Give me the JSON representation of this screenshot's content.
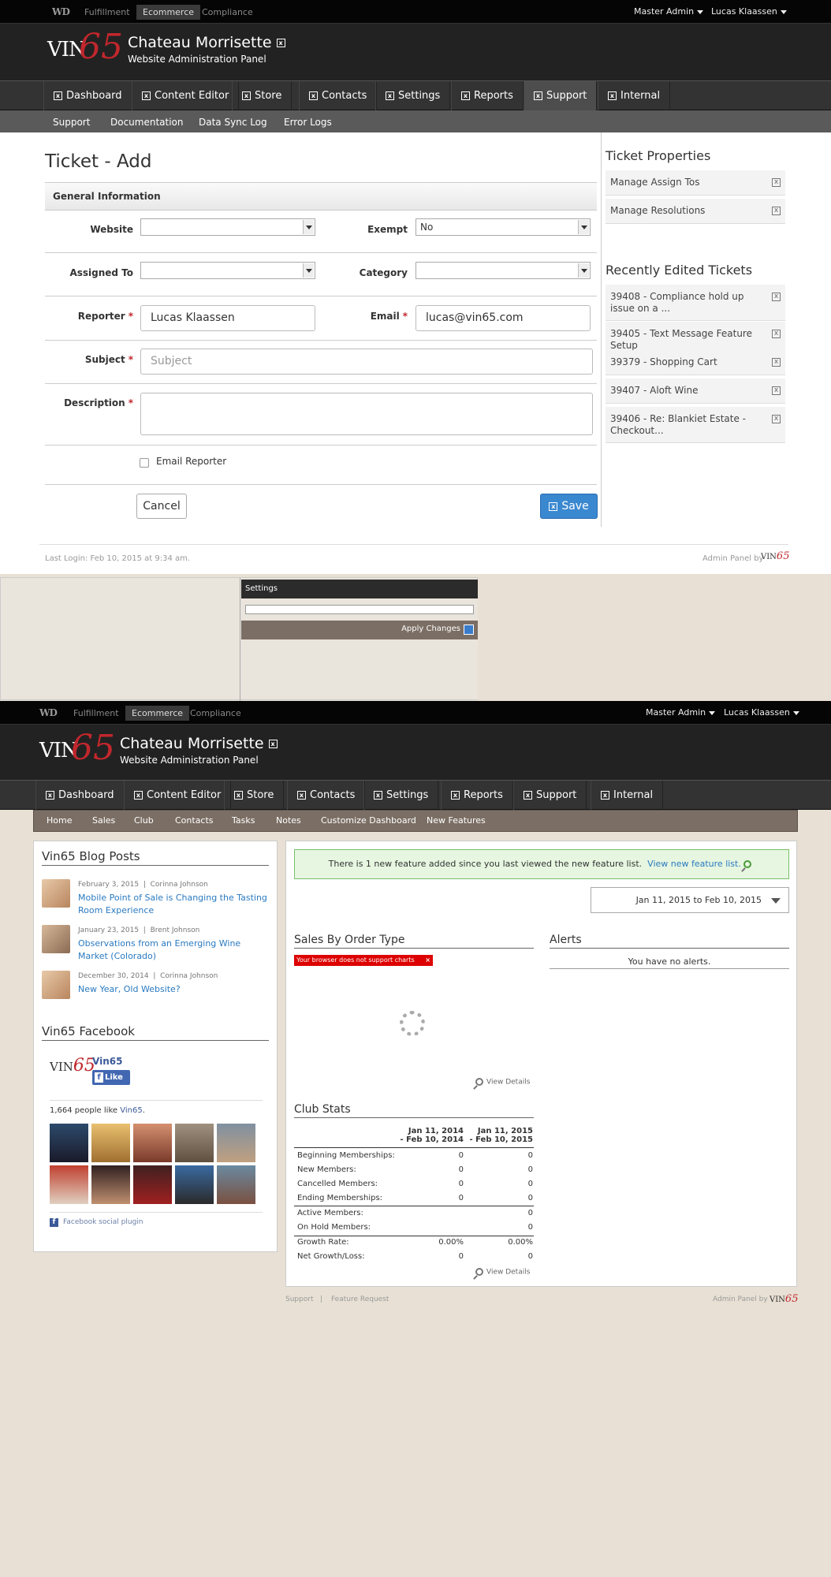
{
  "topbar": {
    "wd": "WD",
    "tabs": [
      "Fulfillment",
      "Ecommerce",
      "Compliance"
    ],
    "master": "Master Admin",
    "user": "Lucas Klaassen"
  },
  "header": {
    "logo_vin": "VIN",
    "logo_65": "65",
    "title": "Chateau Morrisette",
    "subtitle": "Website Administration Panel"
  },
  "nav": [
    "Dashboard",
    "Content Editor",
    "Store",
    "Contacts",
    "Settings",
    "Reports",
    "Support",
    "Internal"
  ],
  "subnav": [
    "Support",
    "Documentation",
    "Data Sync Log",
    "Error Logs"
  ],
  "ticket": {
    "page_title": "Ticket - Add",
    "section": "General Information",
    "website_label": "Website",
    "exempt_label": "Exempt",
    "exempt_value": "No",
    "assigned_label": "Assigned To",
    "category_label": "Category",
    "reporter_label": "Reporter",
    "reporter_value": "Lucas Klaassen",
    "email_label": "Email",
    "email_value": "lucas@vin65.com",
    "subject_label": "Subject",
    "subject_placeholder": "Subject",
    "description_label": "Description",
    "required_mark": "*",
    "email_reporter": "Email Reporter",
    "cancel": "Cancel",
    "save": "Save"
  },
  "sidebar": {
    "props_title": "Ticket Properties",
    "props": [
      "Manage Assign Tos",
      "Manage Resolutions"
    ],
    "recent_title": "Recently Edited Tickets",
    "recent": [
      "39408 - Compliance hold up issue on a ...",
      "39405 - Text Message Feature Setup",
      "39379 - Shopping Cart",
      "39407 - Aloft Wine",
      "39406 - Re: Blankiet Estate - Checkout..."
    ]
  },
  "footer1": {
    "last_login": "Last Login: Feb 10, 2015 at 9:34 am.",
    "admin_by": "Admin Panel by"
  },
  "settings_panel": {
    "title": "Settings",
    "apply": "Apply Changes"
  },
  "dashboard": {
    "subnav": [
      "Home",
      "Sales",
      "Club",
      "Contacts",
      "Tasks",
      "Notes",
      "Customize Dashboard",
      "New Features"
    ],
    "blog_title": "Vin65 Blog Posts",
    "posts": [
      {
        "date": "February 3, 2015",
        "sep": "|",
        "author": "Corinna Johnson",
        "title": "Mobile Point of Sale is Changing the Tasting Room Experience"
      },
      {
        "date": "January 23, 2015",
        "sep": "|",
        "author": "Brent Johnson",
        "title": "Observations from an Emerging Wine Market (Colorado)"
      },
      {
        "date": "December 30, 2014",
        "sep": "|",
        "author": "Corinna Johnson",
        "title": "New Year, Old Website?"
      }
    ],
    "fb_title": "Vin65 Facebook",
    "fb_name": "Vin65",
    "fb_like": "Like",
    "fb_count_pre": "1,664 people like ",
    "fb_count_link": "Vin65",
    "fb_count_post": ".",
    "fb_plugin": "Facebook social plugin",
    "notice_text": "There is 1 new feature added since you last viewed the new feature list.",
    "notice_link": "View new feature list.",
    "date_range": "Jan 11, 2015 to Feb 10, 2015",
    "sales_title": "Sales By Order Type",
    "chart_error": "Your browser does not support charts",
    "view_details": "View Details",
    "alerts_title": "Alerts",
    "alerts_empty": "You have no alerts.",
    "club_title": "Club Stats",
    "col1_a": "Jan 11, 2014",
    "col1_b": "- Feb 10, 2014",
    "col2_a": "Jan 11, 2015",
    "col2_b": "- Feb 10, 2015",
    "stats": [
      {
        "label": "Beginning Memberships:",
        "v1": "0",
        "v2": "0"
      },
      {
        "label": "New Members:",
        "v1": "0",
        "v2": "0"
      },
      {
        "label": "Cancelled Members:",
        "v1": "0",
        "v2": "0"
      },
      {
        "label": "Ending Memberships:",
        "v1": "0",
        "v2": "0"
      },
      {
        "label": "Active Members:",
        "v1": "",
        "v2": "0"
      },
      {
        "label": "On Hold Members:",
        "v1": "",
        "v2": "0"
      },
      {
        "label": "Growth Rate:",
        "v1": "0.00%",
        "v2": "0.00%"
      },
      {
        "label": "Net Growth/Loss:",
        "v1": "0",
        "v2": "0"
      }
    ],
    "footer_support": "Support",
    "footer_sep": "|",
    "footer_feature": "Feature Request",
    "admin_by": "Admin Panel by"
  }
}
